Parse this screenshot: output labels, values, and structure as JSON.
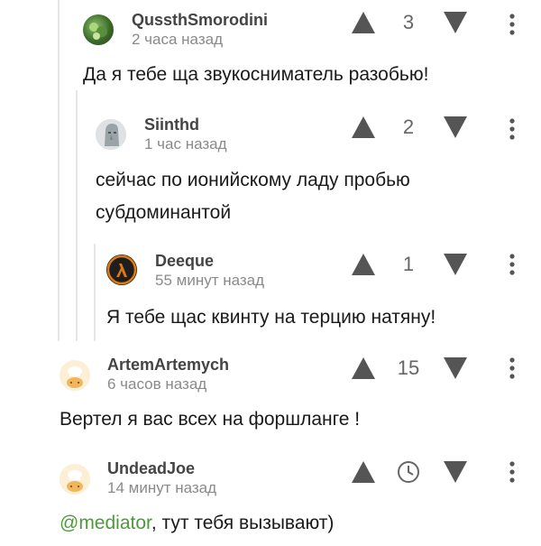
{
  "colors": {
    "vote_icon": "#555555",
    "mention": "#4c9a3a",
    "thread_line": "#e6e6e6",
    "muted_text": "#8a8a8a"
  },
  "comments": [
    {
      "author": "QussthSmorodini",
      "time": "2 часа назад",
      "rating": "3",
      "text": "Да я тебе ща звукосниматель разобью!"
    },
    {
      "author": "Siinthd",
      "time": "1 час назад",
      "rating": "2",
      "text_line1": "сейчас по ионийскому ладу пробью",
      "text_line2": "субдоминантой"
    },
    {
      "author": "Deeque",
      "time": "55 минут назад",
      "rating": "1",
      "text": "Я тебе щас квинту на терцию натяну!"
    },
    {
      "author": "ArtemArtemych",
      "time": "6 часов назад",
      "rating": "15",
      "text": "Вертел я вас всех на форшланге !"
    },
    {
      "author": "UndeadJoe",
      "time": "14 минут назад",
      "rating_icon": "clock-icon",
      "mention": "@mediator",
      "text_after_mention": ", тут тебя вызывают)"
    }
  ]
}
